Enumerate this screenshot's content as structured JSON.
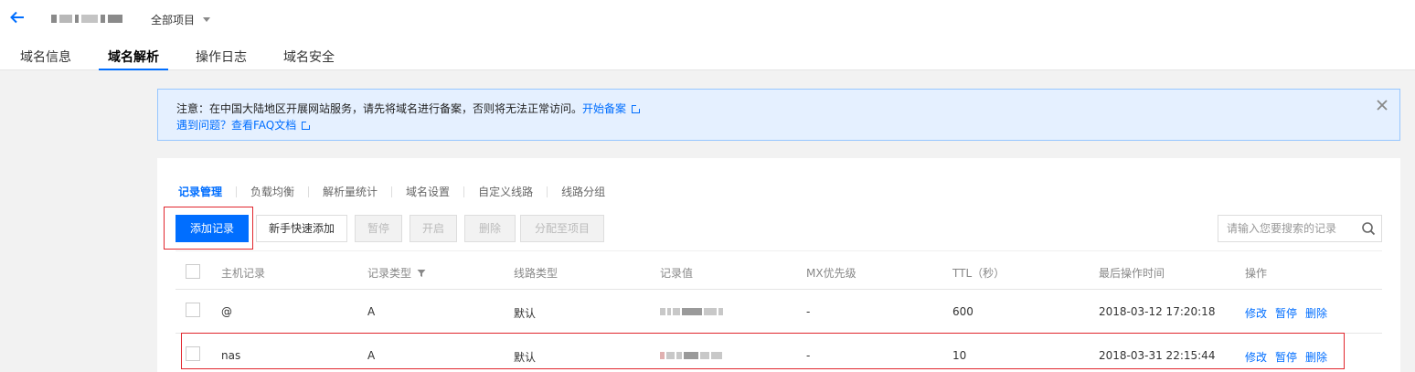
{
  "header": {
    "project": "全部项目",
    "tabs": [
      {
        "label": "域名信息",
        "active": false
      },
      {
        "label": "域名解析",
        "active": true
      },
      {
        "label": "操作日志",
        "active": false
      },
      {
        "label": "域名安全",
        "active": false
      }
    ]
  },
  "notice": {
    "line1_text": "注意：在中国大陆地区开展网站服务，请先将域名进行备案，否则将无法正常访问。",
    "line1_link": "开始备案",
    "line2_link": "遇到问题？查看FAQ文档"
  },
  "subtabs": [
    {
      "label": "记录管理",
      "active": true
    },
    {
      "label": "负载均衡",
      "active": false
    },
    {
      "label": "解析量统计",
      "active": false
    },
    {
      "label": "域名设置",
      "active": false
    },
    {
      "label": "自定义线路",
      "active": false
    },
    {
      "label": "线路分组",
      "active": false
    }
  ],
  "toolbar": {
    "add": "添加记录",
    "quick_add": "新手快速添加",
    "pause": "暂停",
    "enable": "开启",
    "delete": "删除",
    "assign": "分配至项目"
  },
  "search": {
    "placeholder": "请输入您要搜索的记录"
  },
  "table": {
    "headers": {
      "host": "主机记录",
      "type": "记录类型",
      "line": "线路类型",
      "value": "记录值",
      "mx": "MX优先级",
      "ttl": "TTL（秒）",
      "time": "最后操作时间",
      "ops": "操作"
    },
    "rows": [
      {
        "host": "@",
        "type": "A",
        "line": "默认",
        "mx": "-",
        "ttl": "600",
        "time": "2018-03-12 17:20:18",
        "edit": "修改",
        "pause": "暂停",
        "delete": "删除"
      },
      {
        "host": "nas",
        "type": "A",
        "line": "默认",
        "mx": "-",
        "ttl": "10",
        "time": "2018-03-31 22:15:44",
        "edit": "修改",
        "pause": "暂停",
        "delete": "删除"
      }
    ]
  },
  "colors": {
    "accent": "#006eff",
    "highlight": "#e1262d",
    "notice_bg": "#e5f0ff"
  }
}
